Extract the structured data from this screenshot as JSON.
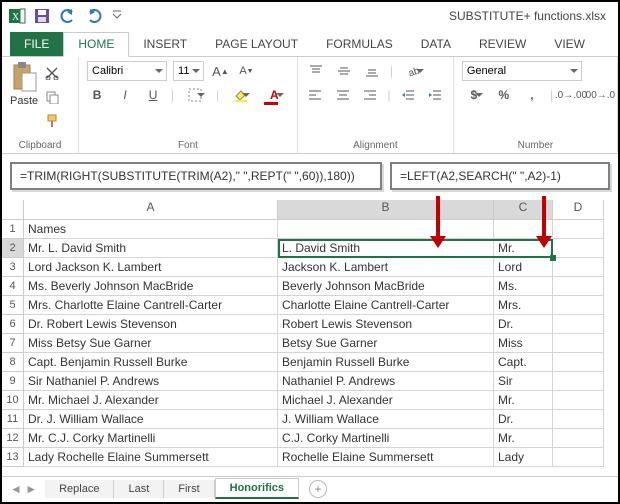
{
  "titlebar": {
    "filename": "SUBSTITUTE+ functions.xlsx"
  },
  "tabs": {
    "file": "FILE",
    "home": "HOME",
    "insert": "INSERT",
    "pagelayout": "PAGE LAYOUT",
    "formulas": "FORMULAS",
    "data": "DATA",
    "review": "REVIEW",
    "view": "VIEW"
  },
  "ribbon": {
    "clipboard": {
      "paste": "Paste",
      "label": "Clipboard"
    },
    "font": {
      "name": "Calibri",
      "size": "11",
      "label": "Font"
    },
    "alignment": {
      "label": "Alignment"
    },
    "number": {
      "format": "General",
      "label": "Number"
    }
  },
  "formulas": {
    "b": "=TRIM(RIGHT(SUBSTITUTE(TRIM(A2),\" \",REPT(\" \",60)),180))",
    "c": "=LEFT(A2,SEARCH(\" \",A2)-1)"
  },
  "columns": {
    "A": "A",
    "B": "B",
    "C": "C",
    "D": "D"
  },
  "header_row": {
    "A": "Names"
  },
  "rows": [
    {
      "n": "1",
      "A": "Names",
      "B": "",
      "C": ""
    },
    {
      "n": "2",
      "A": "Mr. L. David Smith",
      "B": "L. David Smith",
      "C": "Mr."
    },
    {
      "n": "3",
      "A": "Lord Jackson K. Lambert",
      "B": "Jackson K. Lambert",
      "C": "Lord"
    },
    {
      "n": "4",
      "A": "Ms. Beverly Johnson MacBride",
      "B": "Beverly Johnson MacBride",
      "C": "Ms."
    },
    {
      "n": "5",
      "A": "Mrs. Charlotte Elaine Cantrell-Carter",
      "B": "Charlotte Elaine Cantrell-Carter",
      "C": "Mrs."
    },
    {
      "n": "6",
      "A": "Dr. Robert Lewis Stevenson",
      "B": "Robert Lewis Stevenson",
      "C": "Dr."
    },
    {
      "n": "7",
      "A": "Miss Betsy Sue Garner",
      "B": "Betsy Sue Garner",
      "C": "Miss"
    },
    {
      "n": "8",
      "A": "Capt. Benjamin Russell Burke",
      "B": "Benjamin Russell Burke",
      "C": "Capt."
    },
    {
      "n": "9",
      "A": "Sir Nathaniel P. Andrews",
      "B": "Nathaniel P. Andrews",
      "C": "Sir"
    },
    {
      "n": "10",
      "A": "Mr. Michael J. Alexander",
      "B": "Michael J. Alexander",
      "C": "Mr."
    },
    {
      "n": "11",
      "A": "Dr. J. William Wallace",
      "B": "J. William Wallace",
      "C": "Dr."
    },
    {
      "n": "12",
      "A": "Mr. C.J. Corky Martinelli",
      "B": "C.J. Corky Martinelli",
      "C": "Mr."
    },
    {
      "n": "13",
      "A": "Lady Rochelle Elaine Summersett",
      "B": "Rochelle Elaine Summersett",
      "C": "Lady"
    }
  ],
  "sheets": {
    "replace": "Replace",
    "last": "Last",
    "first": "First",
    "honorifics": "Honorifics"
  }
}
